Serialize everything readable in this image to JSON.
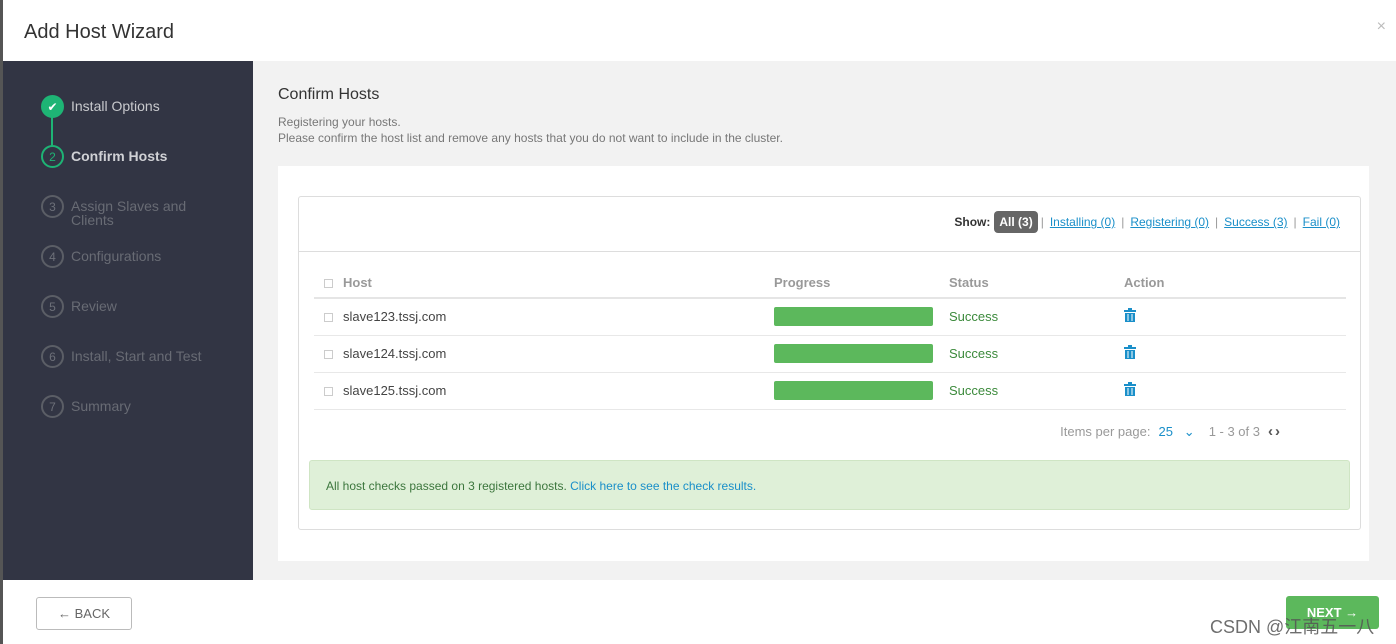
{
  "window": {
    "title": "Add Host Wizard",
    "close": "×"
  },
  "steps": [
    {
      "num": "✔",
      "label": "Install Options",
      "state": "done"
    },
    {
      "num": "2",
      "label": "Confirm Hosts",
      "state": "active"
    },
    {
      "num": "3",
      "label": "Assign Slaves and Clients",
      "state": "pending"
    },
    {
      "num": "4",
      "label": "Configurations",
      "state": "pending"
    },
    {
      "num": "5",
      "label": "Review",
      "state": "pending"
    },
    {
      "num": "6",
      "label": "Install, Start and Test",
      "state": "pending"
    },
    {
      "num": "7",
      "label": "Summary",
      "state": "pending"
    }
  ],
  "main": {
    "title": "Confirm Hosts",
    "line1": "Registering your hosts.",
    "line2": "Please confirm the host list and remove any hosts that you do not want to include in the cluster."
  },
  "filter": {
    "show": "Show:",
    "all": "All (3)",
    "installing": "Installing (0)",
    "registering": "Registering (0)",
    "success": "Success (3)",
    "fail": "Fail (0)",
    "sep": "|"
  },
  "table": {
    "headers": [
      "Host",
      "Progress",
      "Status",
      "Action"
    ],
    "rows": [
      {
        "host": "slave123.tssj.com",
        "progress": 100,
        "status": "Success"
      },
      {
        "host": "slave124.tssj.com",
        "progress": 100,
        "status": "Success"
      },
      {
        "host": "slave125.tssj.com",
        "progress": 100,
        "status": "Success"
      }
    ]
  },
  "pager": {
    "label": "Items per page:",
    "value": "25",
    "range": "1 - 3 of 3"
  },
  "alert": {
    "text": "All host checks passed on 3 registered hosts. ",
    "link": "Click here to see the check results."
  },
  "footer": {
    "back": "← BACK",
    "next": "NEXT →"
  },
  "watermark": "CSDN @江南五一八",
  "colors": {
    "accent": "#1eb475",
    "success": "#5cb85c",
    "link": "#1a8fc9"
  }
}
